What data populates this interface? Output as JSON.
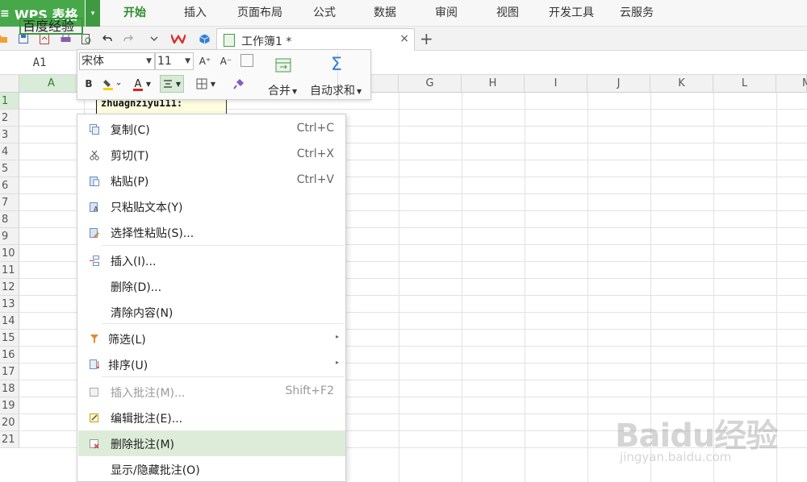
{
  "app": {
    "name": "WPS 表格",
    "menu_glyph": "≡",
    "dropdown_glyph": "▾",
    "accent": "#47a84a"
  },
  "tabs": [
    "开始",
    "插入",
    "页面布局",
    "公式",
    "数据",
    "审阅",
    "视图",
    "开发工具",
    "云服务"
  ],
  "active_tab": "开始",
  "quick_bar": {
    "icons": [
      "open-icon",
      "save-icon",
      "export-icon",
      "print-icon",
      "print-preview-icon",
      "undo-icon",
      "redo-icon",
      "customize-icon"
    ],
    "doc_tab": {
      "title": "工作簿1 *",
      "close": "×"
    },
    "new_tab": "+"
  },
  "formula_bar": {
    "name_box": "A1"
  },
  "mini_toolbar": {
    "font": "宋体",
    "size": "11",
    "bold": "B",
    "grow": "A⁺",
    "shrink": "A⁻",
    "font_color": "A",
    "merge_label": "合并",
    "autosum_label": "自动求和",
    "autosum_glyph": "Σ"
  },
  "columns": [
    "A",
    "",
    "",
    "",
    "",
    "",
    "G",
    "H",
    "I",
    "J",
    "K",
    "L",
    "M"
  ],
  "rows": [
    "1",
    "2",
    "3",
    "4",
    "5",
    "6",
    "7",
    "8",
    "9",
    "10",
    "11",
    "12",
    "13",
    "14",
    "15",
    "16",
    "17",
    "18",
    "19",
    "20",
    "21"
  ],
  "cells": {
    "A1": "百度经验"
  },
  "comment": {
    "text": "zhuagnziyu111:"
  },
  "context_menu": {
    "items": [
      {
        "label": "复制(C)",
        "shortcut": "Ctrl+C",
        "icon": "copy-icon"
      },
      {
        "label": "剪切(T)",
        "shortcut": "Ctrl+X",
        "icon": "cut-icon"
      },
      {
        "label": "粘贴(P)",
        "shortcut": "Ctrl+V",
        "icon": "paste-icon"
      },
      {
        "label": "只粘贴文本(Y)",
        "shortcut": "",
        "icon": "paste-text-icon"
      },
      {
        "label": "选择性粘贴(S)...",
        "shortcut": "",
        "icon": "paste-special-icon"
      },
      {
        "label": "插入(I)...",
        "shortcut": "",
        "icon": "insert-icon"
      },
      {
        "label": "删除(D)...",
        "shortcut": "",
        "icon": ""
      },
      {
        "label": "清除内容(N)",
        "shortcut": "",
        "icon": ""
      },
      {
        "label": "筛选(L)",
        "shortcut": "",
        "icon": "filter-icon",
        "submenu": true
      },
      {
        "label": "排序(U)",
        "shortcut": "",
        "icon": "sort-icon",
        "submenu": true
      },
      {
        "label": "插入批注(M)...",
        "shortcut": "Shift+F2",
        "icon": "insert-comment-icon",
        "disabled": true
      },
      {
        "label": "编辑批注(E)...",
        "shortcut": "",
        "icon": "edit-comment-icon"
      },
      {
        "label": "删除批注(M)",
        "shortcut": "",
        "icon": "delete-comment-icon",
        "highlighted": true
      },
      {
        "label": "显示/隐藏批注(O)",
        "shortcut": "",
        "icon": ""
      }
    ]
  },
  "watermark": {
    "main": "Baidu经验",
    "sub": "jingyan.baidu.com"
  }
}
